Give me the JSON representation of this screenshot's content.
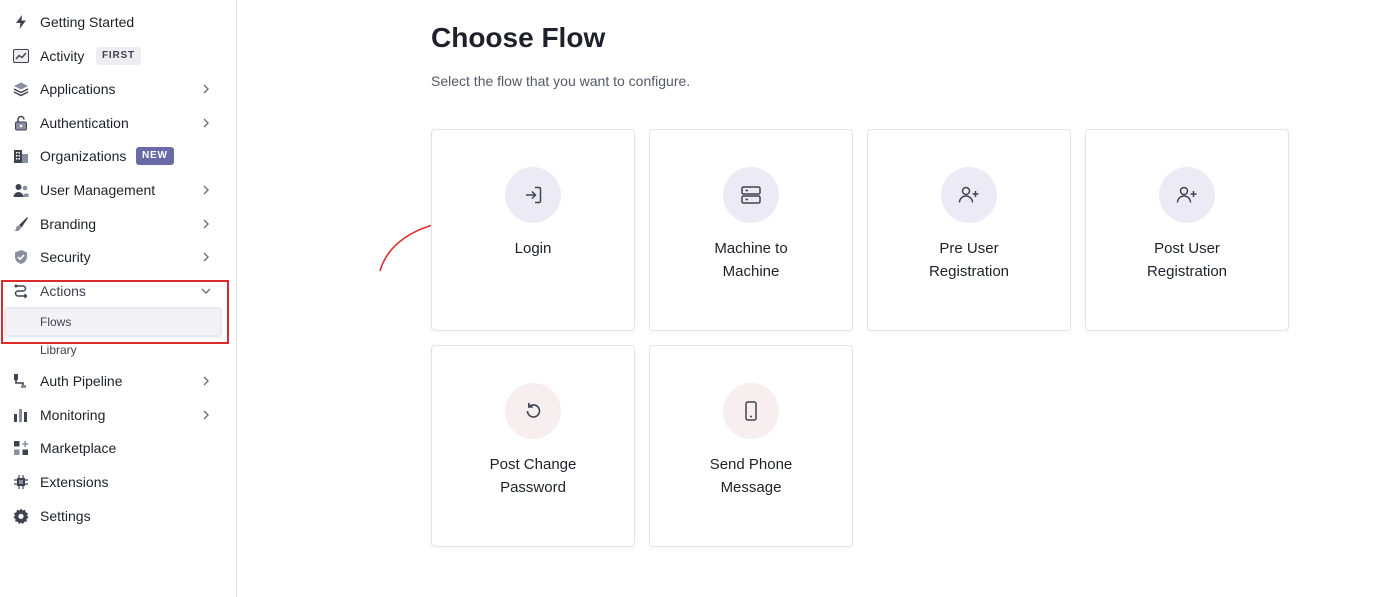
{
  "sidebar": {
    "items": [
      {
        "label": "Getting Started"
      },
      {
        "label": "Activity",
        "badge": "FIRST"
      },
      {
        "label": "Applications"
      },
      {
        "label": "Authentication"
      },
      {
        "label": "Organizations",
        "badge": "NEW"
      },
      {
        "label": "User Management"
      },
      {
        "label": "Branding"
      },
      {
        "label": "Security"
      },
      {
        "label": "Actions",
        "subitems": [
          {
            "label": "Flows"
          },
          {
            "label": "Library"
          }
        ]
      },
      {
        "label": "Auth Pipeline"
      },
      {
        "label": "Monitoring"
      },
      {
        "label": "Marketplace"
      },
      {
        "label": "Extensions"
      },
      {
        "label": "Settings"
      }
    ]
  },
  "main": {
    "title": "Choose Flow",
    "subtitle": "Select the flow that you want to configure.",
    "flows": [
      {
        "line1": "Login",
        "line2": "",
        "icon": "login-icon"
      },
      {
        "line1": "Machine to",
        "line2": "Machine",
        "icon": "server-icon"
      },
      {
        "line1": "Pre User",
        "line2": "Registration",
        "icon": "user-plus-icon"
      },
      {
        "line1": "Post User",
        "line2": "Registration",
        "icon": "user-plus-icon"
      },
      {
        "line1": "Post Change",
        "line2": "Password",
        "icon": "rotate-ccw-icon"
      },
      {
        "line1": "Send Phone",
        "line2": "Message",
        "icon": "smartphone-icon"
      }
    ]
  },
  "colors": {
    "highlight": "#d92b2b",
    "badge_new": "#6b6aa8",
    "icon_circle_purple": "#ecebf5",
    "icon_circle_pink": "#f6eeef"
  }
}
